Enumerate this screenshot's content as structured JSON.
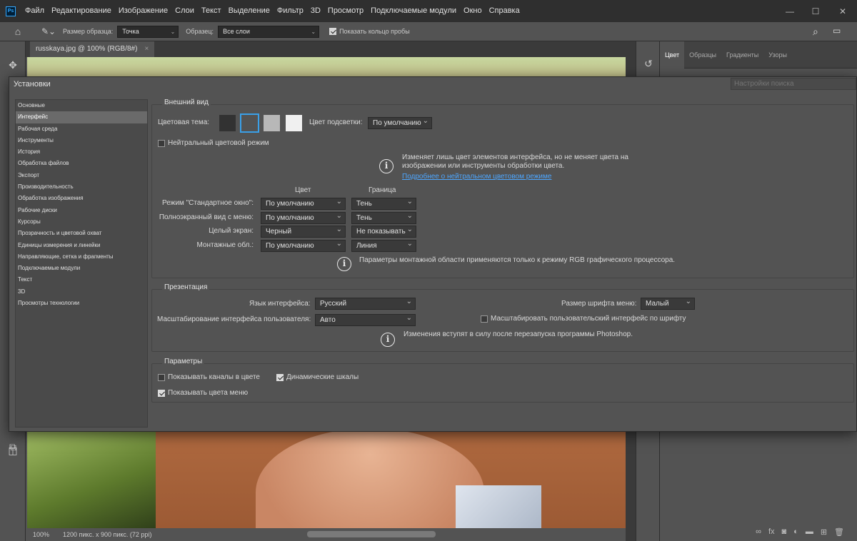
{
  "app": {
    "logo": "Ps",
    "menu": [
      "Файл",
      "Редактирование",
      "Изображение",
      "Слои",
      "Текст",
      "Выделение",
      "Фильтр",
      "3D",
      "Просмотр",
      "Подключаемые модули",
      "Окно",
      "Справка"
    ],
    "window_controls": {
      "minimize": "—",
      "maximize": "☐",
      "close": "✕"
    }
  },
  "options_bar": {
    "sample_size_label": "Размер образца:",
    "sample_size_value": "Точка",
    "sample_label": "Образец:",
    "sample_value": "Все слои",
    "show_ring_label": "Показать кольцо пробы",
    "show_ring_checked": true
  },
  "document": {
    "tab_title": "russkaya.jpg @ 100% (RGB/8#)",
    "tab_close": "×",
    "zoom": "100%",
    "info": "1200 пикс. x 900 пикс. (72 ppi)"
  },
  "right_panel": {
    "tabs": [
      "Цвет",
      "Образцы",
      "Градиенты",
      "Узоры"
    ],
    "active_tab": "Цвет"
  },
  "dialog": {
    "title": "Установки",
    "search_placeholder": "Настройки поиска",
    "nav": [
      "Основные",
      "Интерфейс",
      "Рабочая среда",
      "Инструменты",
      "История",
      "Обработка файлов",
      "Экспорт",
      "Производительность",
      "Обработка изображения",
      "Рабочие диски",
      "Курсоры",
      "Прозрачность и цветовой охват",
      "Единицы измерения и линейки",
      "Направляющие, сетка и фрагменты",
      "Подключаемые модули",
      "Текст",
      "3D",
      "Просмотры технологии"
    ],
    "nav_active_index": 1,
    "appearance": {
      "title": "Внешний вид",
      "color_theme_label": "Цветовая тема:",
      "theme_colors": [
        "#323232",
        "#535353",
        "#b8b8b8",
        "#f0f0f0"
      ],
      "selected_theme_index": 1,
      "highlight_label": "Цвет подсветки:",
      "highlight_value": "По умолчанию",
      "neutral_mode_label": "Нейтральный цветовой режим",
      "neutral_mode_checked": false,
      "info_line1": "Изменяет лишь цвет элементов интерфейса, но не меняет цвета на",
      "info_line2": "изображении или инструменты обработки цвета.",
      "info_link": "Подробнее о нейтральном цветовом режиме",
      "col_color": "Цвет",
      "col_border": "Граница",
      "rows": [
        {
          "label": "Режим \"Стандартное окно\":",
          "color": "По умолчанию",
          "border": "Тень"
        },
        {
          "label": "Полноэкранный вид с меню:",
          "color": "По умолчанию",
          "border": "Тень"
        },
        {
          "label": "Целый экран:",
          "color": "Черный",
          "border": "Не показывать"
        },
        {
          "label": "Монтажные обл.:",
          "color": "По умолчанию",
          "border": "Линия"
        }
      ],
      "artboard_note": "Параметры монтажной области применяются только к режиму RGB графического процессора."
    },
    "presentation": {
      "title": "Презентация",
      "ui_language_label": "Язык интерфейса:",
      "ui_language_value": "Русский",
      "menu_font_label": "Размер шрифта меню:",
      "menu_font_value": "Малый",
      "ui_scaling_label": "Масштабирование интерфейса пользователя:",
      "ui_scaling_value": "Авто",
      "scale_to_font_label": "Масштабировать пользовательский интерфейс по шрифту",
      "scale_to_font_checked": false,
      "restart_note": "Изменения вступят в силу после перезапуска программы Photoshop."
    },
    "parameters": {
      "title": "Параметры",
      "show_channels_color_label": "Показывать каналы в цвете",
      "show_channels_color_checked": false,
      "dynamic_sliders_label": "Динамические шкалы",
      "dynamic_sliders_checked": true,
      "show_menu_colors_label": "Показывать цвета меню",
      "show_menu_colors_checked": true
    }
  }
}
